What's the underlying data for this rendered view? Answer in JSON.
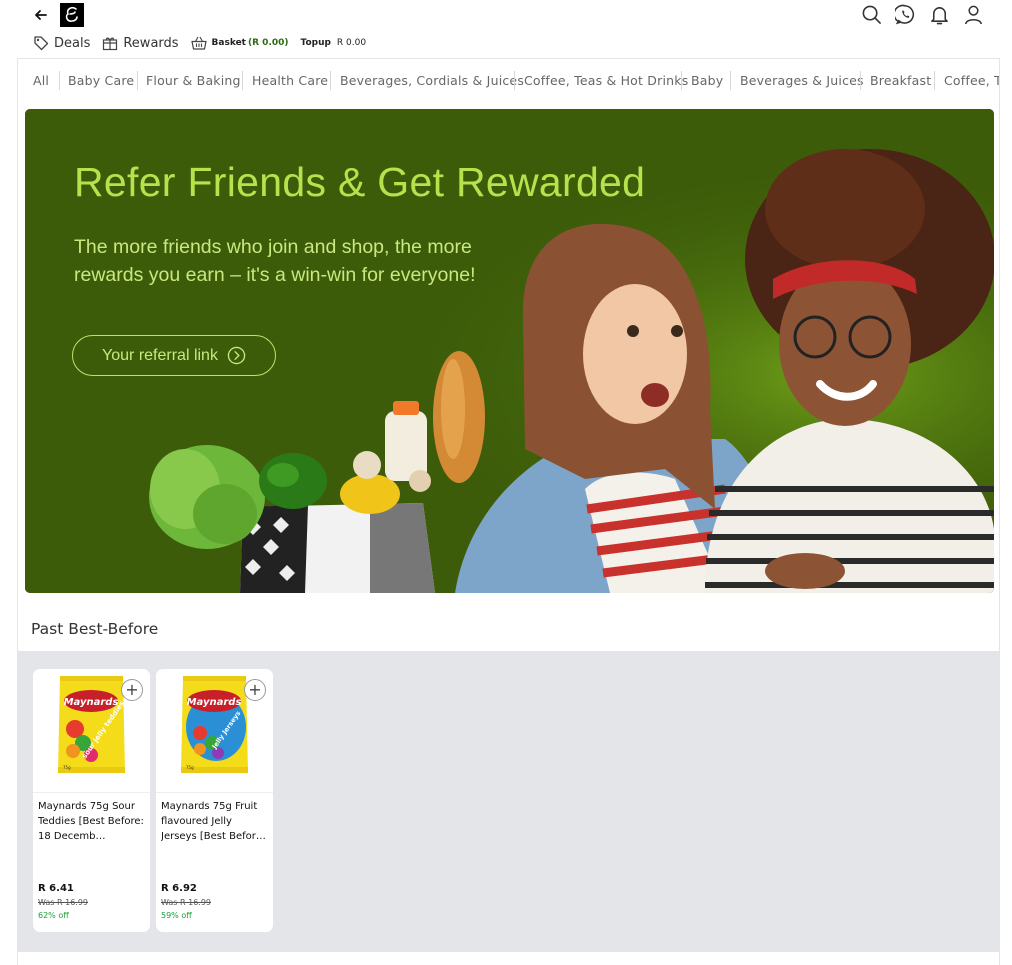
{
  "header": {
    "back_icon": "back-arrow-icon",
    "logo_icon": "brand-logo",
    "icons": [
      "search-icon",
      "whatsapp-icon",
      "bell-icon",
      "user-icon"
    ]
  },
  "subnav": {
    "deals": "Deals",
    "rewards": "Rewards",
    "basket": "Basket",
    "basket_amount": "(R 0.00)",
    "topup": "Topup",
    "topup_amount": "R 0.00"
  },
  "categories": [
    "All",
    "Baby Care",
    "Flour & Baking",
    "Health Care",
    "Beverages, Cordials & Juices",
    "Coffee, Teas & Hot Drinks",
    "Baby",
    "Beverages & Juices",
    "Breakfast",
    "Coffee, Te"
  ],
  "banner": {
    "title": "Refer Friends & Get Rewarded",
    "subtitle": "The more friends who join and shop, the more rewards you earn – it's a win-win for everyone!",
    "button_label": "Your referral link",
    "colors": {
      "background": "#3b5d09",
      "accent": "#b8e24b"
    }
  },
  "section": {
    "title": "Past Best-Before"
  },
  "products": [
    {
      "name": "Maynards 75g Sour Teddies [Best Before: 18 Decemb…",
      "price": "R 6.41",
      "was": "Was R 16.99",
      "off": "62% off",
      "pack_text": "Maynards",
      "pack_sub": "sour jelly teddies"
    },
    {
      "name": "Maynards 75g Fruit flavoured Jelly Jerseys [Best Befor…",
      "price": "R 6.92",
      "was": "Was R 16.99",
      "off": "59% off",
      "pack_text": "Maynards",
      "pack_sub": "Jelly Jerseys"
    }
  ]
}
